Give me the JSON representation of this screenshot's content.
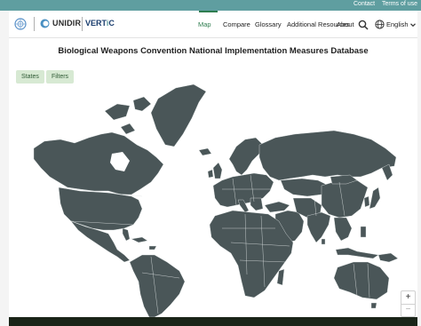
{
  "topbar": {
    "contact": "Contact",
    "terms": "Terms of use"
  },
  "header": {
    "unidir": "UNIDIR",
    "vertic_a": "VERT",
    "vertic_b": "i",
    "vertic_c": "C",
    "nav": [
      "Map",
      "Compare",
      "Glossary",
      "Additional Resources",
      "About"
    ],
    "active_nav": "Map",
    "language": "English"
  },
  "page": {
    "title": "Biological Weapons Convention National Implementation Measures Database"
  },
  "map": {
    "buttons": {
      "states": "States",
      "filters": "Filters"
    },
    "zoom_in": "+",
    "zoom_out": "−",
    "land_color": "#4a5658",
    "border_color": "#dfe5e5"
  },
  "colors": {
    "accent": "#5f9ea0",
    "active_nav": "#2e7d4f",
    "pill_bg": "#d7e9d3"
  }
}
